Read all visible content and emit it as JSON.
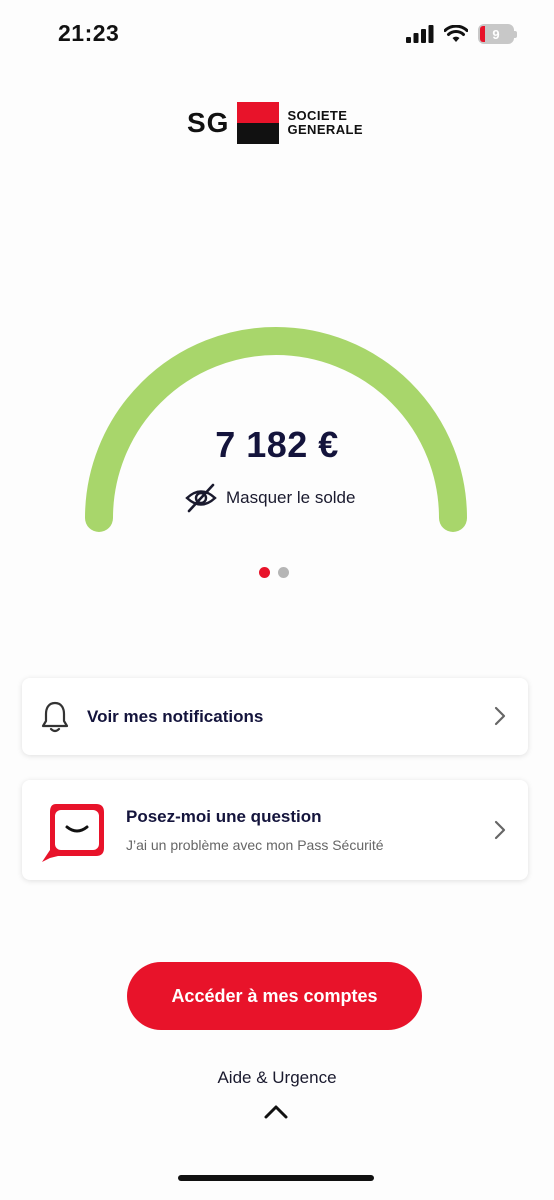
{
  "status_bar": {
    "time": "21:23",
    "battery_level": "9",
    "icons": [
      "signal-icon",
      "wifi-icon",
      "battery-icon"
    ]
  },
  "logo": {
    "sg": "SG",
    "line1": "SOCIETE",
    "line2": "GENERALE"
  },
  "balance": {
    "amount": "7 182 €",
    "hide_label": "Masquer le solde",
    "gauge_color": "#a8d66b"
  },
  "pager": {
    "count": 2,
    "active_index": 0
  },
  "cards": {
    "notifications": {
      "title": "Voir mes notifications",
      "icon": "bell-icon"
    },
    "question": {
      "title": "Posez-moi une question",
      "subtitle": "J’ai un problème avec mon Pass Sécurité",
      "icon": "chat-bubble-icon"
    }
  },
  "cta": {
    "label": "Accéder à mes comptes"
  },
  "help": {
    "label": "Aide & Urgence"
  },
  "colors": {
    "brand_red": "#e8132a",
    "brand_black": "#111111",
    "text_dark": "#14143c"
  }
}
